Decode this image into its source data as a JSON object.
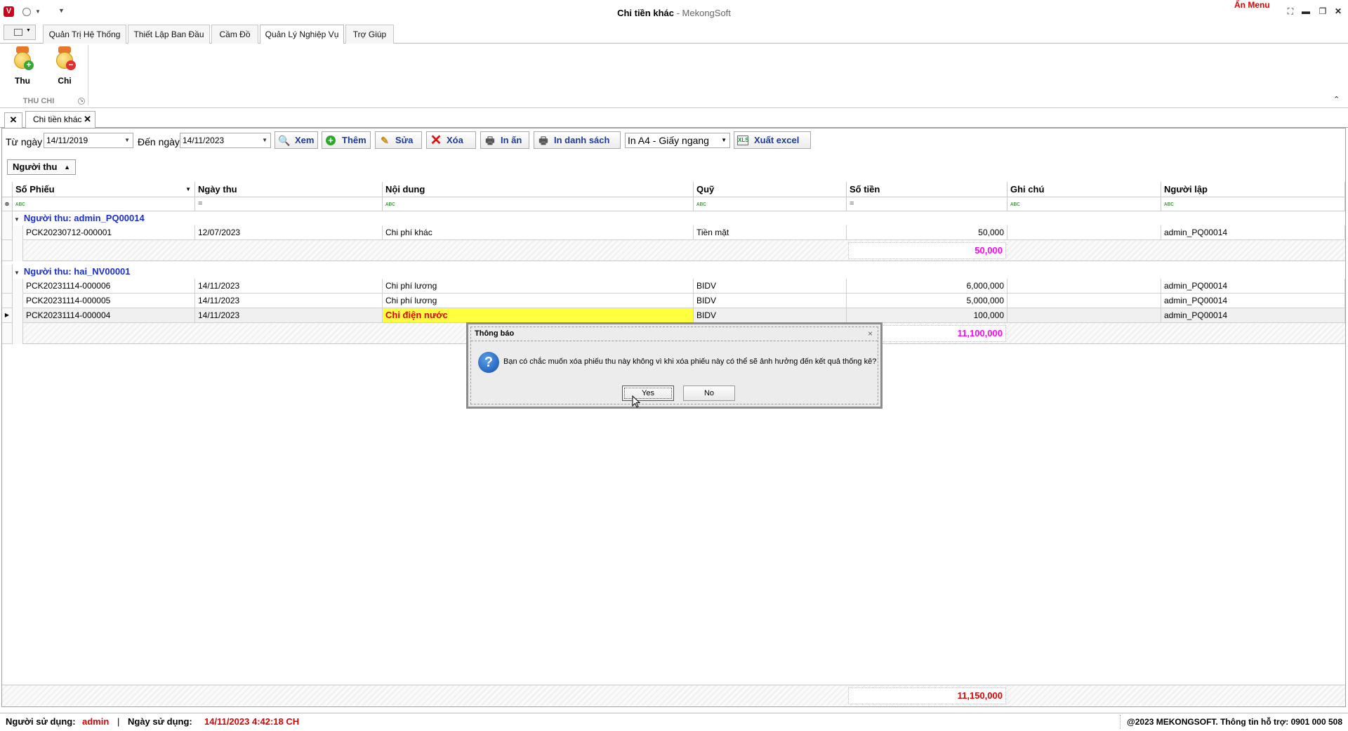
{
  "window": {
    "title": "Chi tiền khác",
    "subtitle": " - MekongSoft",
    "hide_menu": "Ẩn Menu",
    "logo": "V"
  },
  "ribbon_tabs": [
    {
      "label": "Quản Trị Hệ Thống"
    },
    {
      "label": "Thiết Lập Ban Đầu"
    },
    {
      "label": "Cầm Đồ"
    },
    {
      "label": "Quản Lý Nghiệp Vụ",
      "active": true
    },
    {
      "label": "Trợ Giúp"
    }
  ],
  "ribbon": {
    "thu_label": "Thu",
    "chi_label": "Chi",
    "group_label": "THU CHI"
  },
  "doc_tab": {
    "label": "Chi tiền khác"
  },
  "toolbar": {
    "from_label": "Từ ngày",
    "from_value": "14/11/2019",
    "to_label": "Đến ngày",
    "to_value": "14/11/2023",
    "view_label": "Xem",
    "add_label": "Thêm",
    "edit_label": "Sửa",
    "delete_label": "Xóa",
    "print_label": "In ấn",
    "print_list_label": "In danh sách",
    "print_format": "In A4 - Giấy ngang",
    "excel_label": "Xuất excel"
  },
  "group_panel": {
    "chip_label": "Người thu"
  },
  "grid": {
    "columns": [
      "Số Phiếu",
      "Ngày thu",
      "Nội dung",
      "Quỹ",
      "Số tiền",
      "Ghi chú",
      "Người lập"
    ],
    "filters": [
      "ᴀʙc",
      "=",
      "ᴀʙc",
      "ᴀʙc",
      "=",
      "ᴀʙc",
      "ᴀʙc"
    ],
    "groups": [
      {
        "label": "Người thu: admin_PQ00014",
        "rows": [
          {
            "so_phieu": "PCK20230712-000001",
            "ngay_thu": "12/07/2023",
            "noi_dung": "Chi phí khác",
            "quy": "Tiền mặt",
            "so_tien": "50,000",
            "ghi_chu": "",
            "nguoi_lap": "admin_PQ00014"
          }
        ],
        "subtotal": "50,000"
      },
      {
        "label": "Người thu: hai_NV00001",
        "rows": [
          {
            "so_phieu": "PCK20231114-000006",
            "ngay_thu": "14/11/2023",
            "noi_dung": "Chi phí lương",
            "quy": "BIDV",
            "so_tien": "6,000,000",
            "ghi_chu": "",
            "nguoi_lap": "admin_PQ00014"
          },
          {
            "so_phieu": "PCK20231114-000005",
            "ngay_thu": "14/11/2023",
            "noi_dung": "Chi phí lương",
            "quy": "BIDV",
            "so_tien": "5,000,000",
            "ghi_chu": "",
            "nguoi_lap": "admin_PQ00014"
          },
          {
            "so_phieu": "PCK20231114-000004",
            "ngay_thu": "14/11/2023",
            "noi_dung": "Chi điện nước",
            "quy": "BIDV",
            "so_tien": "100,000",
            "ghi_chu": "",
            "nguoi_lap": "admin_PQ00014",
            "selected": true
          }
        ],
        "subtotal": "11,100,000"
      }
    ],
    "grand_total": "11,150,000"
  },
  "status": {
    "user_label": "Người sử dụng:",
    "user_value": "admin",
    "sep": "|",
    "date_label": "Ngày sử dụng:",
    "date_value": "14/11/2023 4:42:18 CH",
    "copyright": "@2023 MEKONGSOFT. Thông tin hỗ trợ: 0901 000 508"
  },
  "dialog": {
    "title": "Thông báo",
    "message": "Bạn có chắc muốn xóa phiếu thu này không vì khi xóa phiếu này có thể sẽ ảnh hưởng đến kết quả thống kê?",
    "yes_label": "Yes",
    "no_label": "No"
  },
  "colors": {
    "subtotal": "#ff00ff",
    "total": "#e00000",
    "group_header": "#1a2fd0",
    "selected_cell": "#ffff40",
    "button_text": "#1d3a9c"
  },
  "icons": [
    "app-logo-icon",
    "qat-circle-icon",
    "thu-coin-icon",
    "chi-coin-icon",
    "search-icon",
    "plus-icon",
    "edit-icon",
    "delete-x-icon",
    "printer-icon",
    "excel-icon",
    "question-icon"
  ]
}
